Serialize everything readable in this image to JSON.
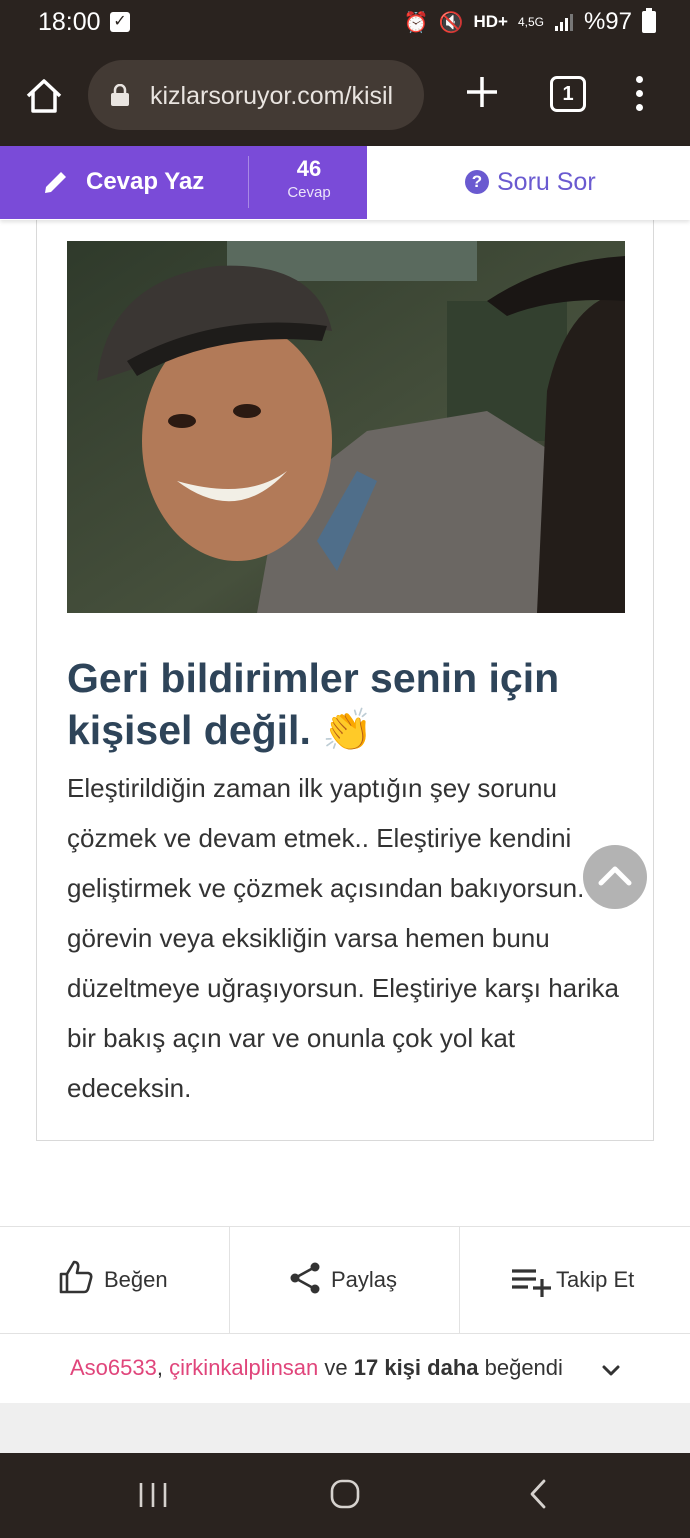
{
  "status_bar": {
    "time": "18:00",
    "network": "4,5G",
    "battery": "%97",
    "hd": "HD+"
  },
  "browser": {
    "url": "kizlarsoruyor.com/kisil",
    "tab_count": "1"
  },
  "action_bar": {
    "write_answer_label": "Cevap Yaz",
    "answer_count": "46",
    "answer_count_label": "Cevap",
    "ask_question_label": "Soru Sor"
  },
  "card": {
    "title": "Geri bildirimler senin için kişisel değil. 👏",
    "body": "Eleştirildiğin zaman ilk yaptığın şey sorunu çözmek ve devam etmek.. Eleştiriye kendini geliştirmek ve çözmek açısından bakıyorsun. Bir görevin veya eksikliğin varsa hemen bunu düzeltmeye uğraşıyorsun. Eleştiriye karşı harika bir bakış açın var ve onunla çok yol kat edeceksin."
  },
  "actions": {
    "like_label": "Beğen",
    "share_label": "Paylaş",
    "follow_label": "Takip Et"
  },
  "likes": {
    "user1": "Aso6533",
    "separator": ", ",
    "user2": "çirkinkalplinsan",
    "and": " ve ",
    "others": "17 kişi daha",
    "suffix": " beğendi"
  },
  "colors": {
    "purple": "#7a4bd8",
    "title_blue": "#2e4459",
    "pink": "#e0457b",
    "dark_bar": "#2a231f"
  }
}
